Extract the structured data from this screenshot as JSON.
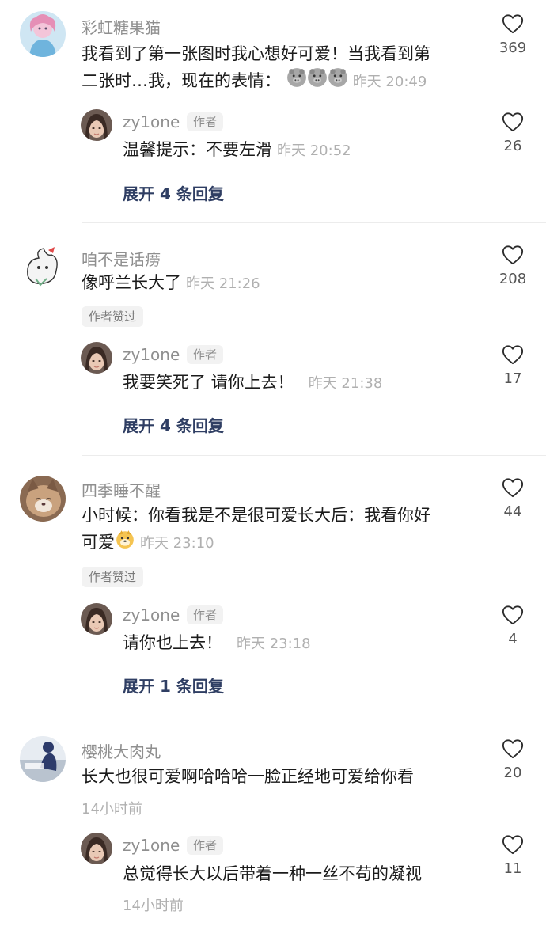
{
  "colors": {
    "accent_expand": "#2f3e63",
    "meta_gray": "#b0b0b0",
    "name_gray": "#8f8f8f"
  },
  "comments": [
    {
      "user": "彩虹糖果猫",
      "text_line1": "我看到了第一张图时我心想好可爱！当我看到第",
      "text_line2": "二张时…我，现在的表情：",
      "emojis": [
        "pig-face-emoji",
        "pig-face-emoji",
        "pig-face-emoji"
      ],
      "time": "昨天 20:49",
      "likes": "369",
      "reply": {
        "user": "zy1one",
        "tag": "作者",
        "text": "温馨提示：不要左滑",
        "time": "昨天 20:52",
        "likes": "26"
      },
      "expand": "展开 4 条回复"
    },
    {
      "user": "咱不是话痨",
      "text": "像呼兰长大了",
      "time": "昨天 21:26",
      "likes": "208",
      "liked_by_author": "作者赞过",
      "reply": {
        "user": "zy1one",
        "tag": "作者",
        "text": "我要笑死了 请你上去！",
        "time": "昨天 21:38",
        "likes": "17"
      },
      "expand": "展开 4 条回复"
    },
    {
      "user": "四季睡不醒",
      "text_line1": "小时候：你看我是不是很可爱长大后：我看你好",
      "text_line2": "可爱",
      "emojis": [
        "dog-face-emoji"
      ],
      "time": "昨天 23:10",
      "likes": "44",
      "liked_by_author": "作者赞过",
      "reply": {
        "user": "zy1one",
        "tag": "作者",
        "text": "请你也上去！",
        "time": "昨天 23:18",
        "likes": "4"
      },
      "expand": "展开 1 条回复"
    },
    {
      "user": "樱桃大肉丸",
      "text": "长大也很可爱啊哈哈哈一脸正经地可爱给你看",
      "time": "14小时前",
      "likes": "20",
      "reply": {
        "user": "zy1one",
        "tag": "作者",
        "text": "总觉得长大以后带着一种一丝不苟的凝视",
        "time": "14小时前",
        "likes": "11"
      }
    }
  ]
}
